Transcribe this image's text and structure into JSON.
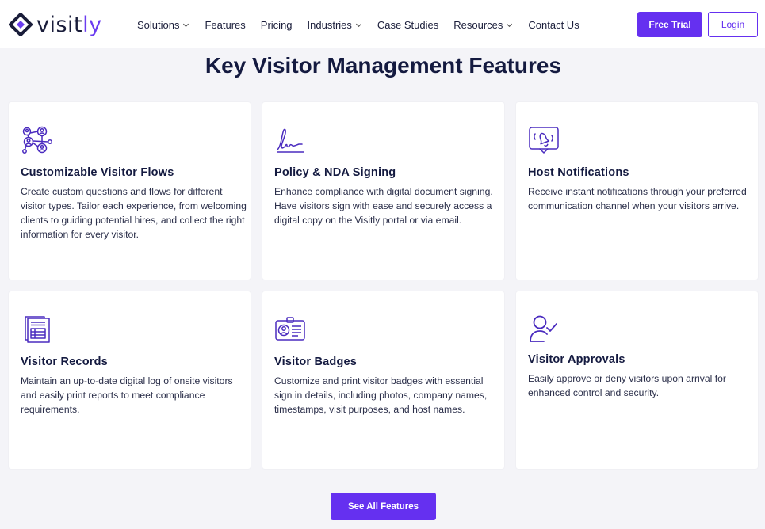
{
  "brand": {
    "name_main": "visit",
    "name_accent": "ly",
    "accent_color": "#6530f0"
  },
  "nav": {
    "items": [
      {
        "label": "Solutions",
        "dropdown": true
      },
      {
        "label": "Features",
        "dropdown": false
      },
      {
        "label": "Pricing",
        "dropdown": false
      },
      {
        "label": "Industries",
        "dropdown": true
      },
      {
        "label": "Case Studies",
        "dropdown": false
      },
      {
        "label": "Resources",
        "dropdown": true
      },
      {
        "label": "Contact Us",
        "dropdown": false
      }
    ],
    "trial_label": "Free Trial",
    "login_label": "Login"
  },
  "section": {
    "title": "Key Visitor Management Features"
  },
  "features": [
    {
      "icon": "visitor-flows-icon",
      "title": "Customizable Visitor Flows",
      "description": "Create custom questions and flows for different visitor types. Tailor each experience, from welcoming clients to guiding potential hires, and collect the right information for every visitor."
    },
    {
      "icon": "signature-icon",
      "title": "Policy & NDA Signing",
      "description": "Enhance compliance with digital document signing. Have visitors sign with ease and securely access a digital copy on the Visitly portal or via email."
    },
    {
      "icon": "notification-bell-icon",
      "title": "Host Notifications",
      "description": "Receive instant notifications through your preferred communication channel when your visitors arrive."
    },
    {
      "icon": "records-document-icon",
      "title": "Visitor Records",
      "description": "Maintain an up-to-date digital log of onsite visitors and easily print reports to meet compliance requirements."
    },
    {
      "icon": "badge-id-icon",
      "title": "Visitor Badges",
      "description": "Customize and print visitor badges with essential sign in details, including photos, company names, timestamps, visit purposes, and host names."
    },
    {
      "icon": "user-check-icon",
      "title": "Visitor Approvals",
      "description": "Easily approve or deny visitors upon arrival for enhanced control and security."
    }
  ],
  "cta": {
    "label": "See All Features"
  }
}
